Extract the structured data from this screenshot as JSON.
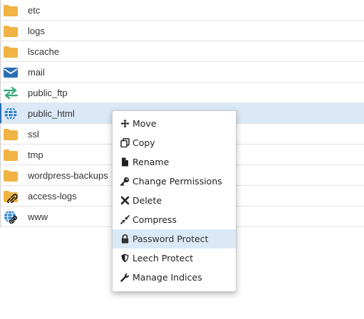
{
  "files": [
    {
      "name": "etc",
      "icon": "folder-icon"
    },
    {
      "name": "logs",
      "icon": "folder-icon"
    },
    {
      "name": "lscache",
      "icon": "folder-icon"
    },
    {
      "name": "mail",
      "icon": "mail-icon"
    },
    {
      "name": "public_ftp",
      "icon": "transfer-arrows-icon"
    },
    {
      "name": "public_html",
      "icon": "globe-icon",
      "selected": true
    },
    {
      "name": "ssl",
      "icon": "folder-icon"
    },
    {
      "name": "tmp",
      "icon": "folder-icon"
    },
    {
      "name": "wordpress-backups",
      "icon": "folder-icon"
    },
    {
      "name": "access-logs",
      "icon": "folder-link-icon"
    },
    {
      "name": "www",
      "icon": "globe-link-icon"
    }
  ],
  "context_menu": {
    "items": [
      {
        "label": "Move",
        "icon": "move-arrows-icon"
      },
      {
        "label": "Copy",
        "icon": "copy-icon"
      },
      {
        "label": "Rename",
        "icon": "file-icon"
      },
      {
        "label": "Change Permissions",
        "icon": "key-icon"
      },
      {
        "label": "Delete",
        "icon": "x-icon"
      },
      {
        "label": "Compress",
        "icon": "compress-icon"
      },
      {
        "label": "Password Protect",
        "icon": "lock-icon",
        "highlighted": true
      },
      {
        "label": "Leech Protect",
        "icon": "shield-icon"
      },
      {
        "label": "Manage Indices",
        "icon": "wrench-icon"
      }
    ]
  },
  "colors": {
    "folder": "#f0b344",
    "mail": "#2a6fb3",
    "ftp_top": "#3aaa7a",
    "ftp_bottom": "#3aaa7a",
    "globe": "#2a7fd0",
    "selection": "#dbe9f7",
    "link": "#222222"
  }
}
